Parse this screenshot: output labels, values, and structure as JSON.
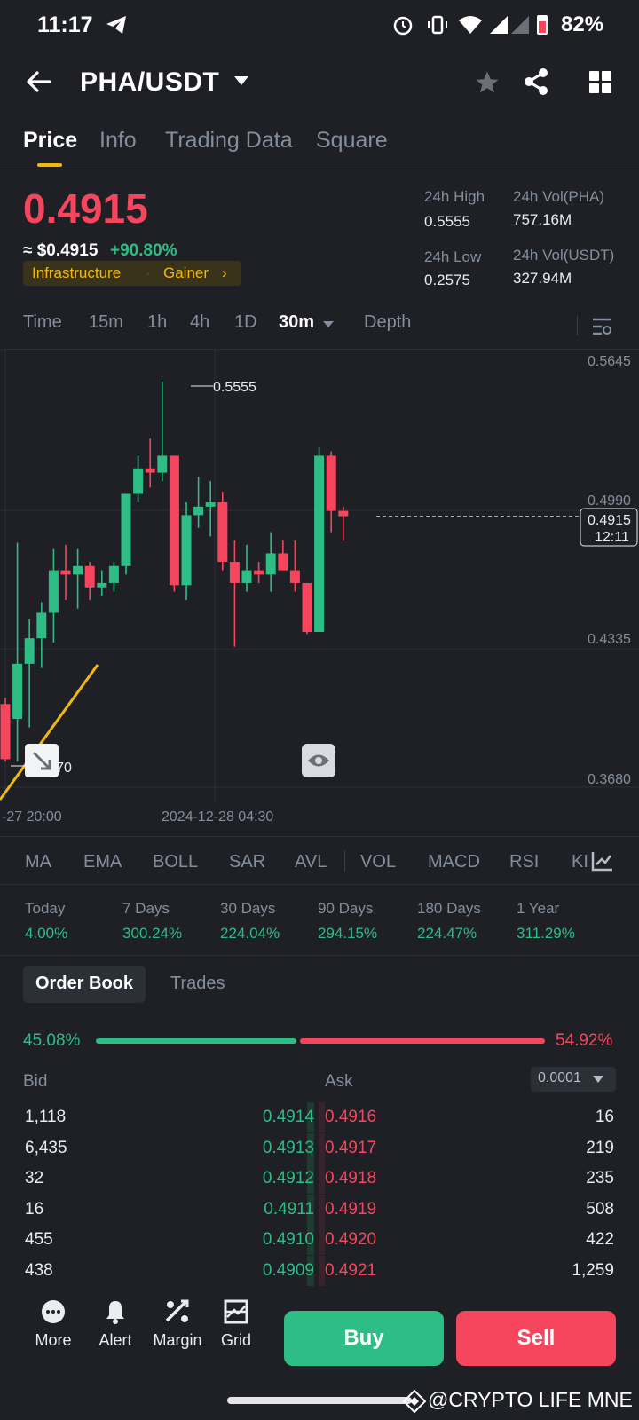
{
  "status": {
    "time": "11:17",
    "battery": "82%"
  },
  "header": {
    "title": "PHA/USDT"
  },
  "tabs": [
    "Price",
    "Info",
    "Trading Data",
    "Square"
  ],
  "price": {
    "last": "0.4915",
    "usd": "≈ $0.4915",
    "change": "+90.80%",
    "tag1": "Infrastructure",
    "tag2": "Gainer",
    "high_label": "24h High",
    "high": "0.5555",
    "low_label": "24h Low",
    "low": "0.2575",
    "vol_base_label": "24h Vol(PHA)",
    "vol_base": "757.16M",
    "vol_quote_label": "24h Vol(USDT)",
    "vol_quote": "327.94M"
  },
  "intervals": [
    "Time",
    "15m",
    "1h",
    "4h",
    "1D",
    "30m",
    "Depth"
  ],
  "chart_labels": {
    "axis": [
      "0.5645",
      "0.4990",
      "0.4335",
      "0.3680"
    ],
    "high_marker": "0.5555",
    "low_marker": "0.3770",
    "price_tag": "0.4915",
    "countdown": "12:11",
    "date_left": "-27 20:00",
    "date_mid": "2024-12-28 04:30"
  },
  "chart_data": {
    "type": "candlestick",
    "ylim": [
      0.368,
      0.5645
    ],
    "candles": [
      {
        "o": 0.403,
        "h": 0.406,
        "l": 0.376,
        "c": 0.377
      },
      {
        "o": 0.396,
        "h": 0.479,
        "l": 0.376,
        "c": 0.422
      },
      {
        "o": 0.422,
        "h": 0.443,
        "l": 0.392,
        "c": 0.434
      },
      {
        "o": 0.434,
        "h": 0.451,
        "l": 0.42,
        "c": 0.446
      },
      {
        "o": 0.446,
        "h": 0.476,
        "l": 0.432,
        "c": 0.466
      },
      {
        "o": 0.466,
        "h": 0.478,
        "l": 0.452,
        "c": 0.464
      },
      {
        "o": 0.464,
        "h": 0.476,
        "l": 0.448,
        "c": 0.468
      },
      {
        "o": 0.468,
        "h": 0.47,
        "l": 0.452,
        "c": 0.458
      },
      {
        "o": 0.458,
        "h": 0.466,
        "l": 0.454,
        "c": 0.46
      },
      {
        "o": 0.46,
        "h": 0.47,
        "l": 0.456,
        "c": 0.468
      },
      {
        "o": 0.468,
        "h": 0.492,
        "l": 0.464,
        "c": 0.502
      },
      {
        "o": 0.502,
        "h": 0.52,
        "l": 0.498,
        "c": 0.514
      },
      {
        "o": 0.514,
        "h": 0.528,
        "l": 0.505,
        "c": 0.512
      },
      {
        "o": 0.512,
        "h": 0.555,
        "l": 0.508,
        "c": 0.52
      },
      {
        "o": 0.52,
        "h": 0.52,
        "l": 0.456,
        "c": 0.459
      },
      {
        "o": 0.459,
        "h": 0.498,
        "l": 0.452,
        "c": 0.492
      },
      {
        "o": 0.492,
        "h": 0.51,
        "l": 0.486,
        "c": 0.496
      },
      {
        "o": 0.496,
        "h": 0.508,
        "l": 0.482,
        "c": 0.498
      },
      {
        "o": 0.498,
        "h": 0.503,
        "l": 0.466,
        "c": 0.47
      },
      {
        "o": 0.47,
        "h": 0.48,
        "l": 0.43,
        "c": 0.46
      },
      {
        "o": 0.46,
        "h": 0.478,
        "l": 0.456,
        "c": 0.466
      },
      {
        "o": 0.466,
        "h": 0.47,
        "l": 0.46,
        "c": 0.464
      },
      {
        "o": 0.464,
        "h": 0.484,
        "l": 0.456,
        "c": 0.474
      },
      {
        "o": 0.474,
        "h": 0.48,
        "l": 0.466,
        "c": 0.466
      },
      {
        "o": 0.466,
        "h": 0.48,
        "l": 0.456,
        "c": 0.46
      },
      {
        "o": 0.46,
        "h": 0.46,
        "l": 0.436,
        "c": 0.437
      },
      {
        "o": 0.437,
        "h": 0.524,
        "l": 0.437,
        "c": 0.52
      },
      {
        "o": 0.52,
        "h": 0.522,
        "l": 0.484,
        "c": 0.494
      },
      {
        "o": 0.494,
        "h": 0.496,
        "l": 0.48,
        "c": 0.4915
      }
    ]
  },
  "indicators": [
    "MA",
    "EMA",
    "BOLL",
    "SAR",
    "AVL",
    "VOL",
    "MACD",
    "RSI",
    "KI"
  ],
  "performance": [
    {
      "label": "Today",
      "value": "4.00%"
    },
    {
      "label": "7 Days",
      "value": "300.24%"
    },
    {
      "label": "30 Days",
      "value": "224.04%"
    },
    {
      "label": "90 Days",
      "value": "294.15%"
    },
    {
      "label": "180 Days",
      "value": "224.47%"
    },
    {
      "label": "1 Year",
      "value": "311.29%"
    }
  ],
  "orderbook": {
    "tab_active": "Order Book",
    "tab_other": "Trades",
    "buy_pct": "45.08%",
    "sell_pct": "54.92%",
    "bid_label": "Bid",
    "ask_label": "Ask",
    "precision": "0.0001",
    "rows": [
      {
        "bq": "1,118",
        "bp": "0.4914",
        "ap": "0.4916",
        "aq": "16"
      },
      {
        "bq": "6,435",
        "bp": "0.4913",
        "ap": "0.4917",
        "aq": "219"
      },
      {
        "bq": "32",
        "bp": "0.4912",
        "ap": "0.4918",
        "aq": "235"
      },
      {
        "bq": "16",
        "bp": "0.4911",
        "ap": "0.4919",
        "aq": "508"
      },
      {
        "bq": "455",
        "bp": "0.4910",
        "ap": "0.4920",
        "aq": "422"
      },
      {
        "bq": "438",
        "bp": "0.4909",
        "ap": "0.4921",
        "aq": "1,259"
      }
    ]
  },
  "bottom": {
    "more": "More",
    "alert": "Alert",
    "margin": "Margin",
    "grid": "Grid",
    "buy": "Buy",
    "sell": "Sell"
  },
  "watermark": "@CRYPTO LIFE MNE",
  "colors": {
    "up": "#2ebd85",
    "down": "#f6465d",
    "accent": "#f0b90b",
    "bg": "#1e2026"
  }
}
